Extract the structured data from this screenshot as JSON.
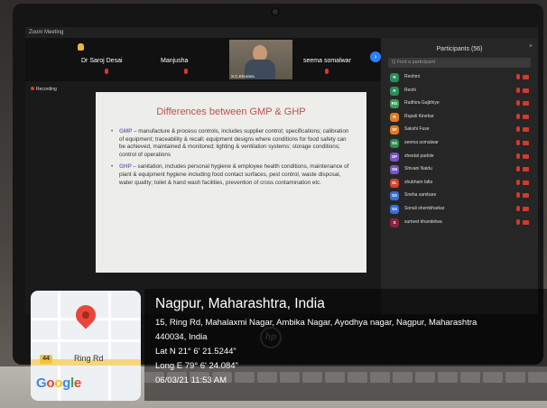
{
  "window": {
    "title": "Zoom Meeting"
  },
  "gallery": {
    "participants": [
      "Dr Saroj Desai",
      "Manjusha",
      "seema somalwar"
    ],
    "active_video_label": "S.C.Khurana"
  },
  "stage": {
    "recording_label": "Recording"
  },
  "slide": {
    "title": "Differences between GMP & GHP",
    "bullets": [
      {
        "keyword": "GMP –",
        "text": " manufacture & process controls, includes supplier control; specifications; calibration of equipment; traceability & recall; equipment designs where conditions for food safety can be achieved, maintained & monitored; lighting & ventilation systems; storage conditions; control of operations"
      },
      {
        "keyword": "GHP –",
        "text": "  sanitation, includes personal hygiene & employee health conditions, maintenance of plant & equipment hygiene including food contact surfaces, pest control, waste disposal, water quality; toilet & hand wash facilities, prevention of cross contamination etc."
      }
    ]
  },
  "participants_panel": {
    "title": "Participants (56)",
    "search_placeholder": "Q Find a participant",
    "items": [
      {
        "initials": "R",
        "name": "Reshmi",
        "color": "#2e8b57"
      },
      {
        "initials": "R",
        "name": "Reshi",
        "color": "#2e8b57"
      },
      {
        "initials": "RG",
        "name": "Rudhira Gajbhiye",
        "color": "#3a9d5d"
      },
      {
        "initials": "R",
        "name": "Rupali Kinekar",
        "color": "#e07b20"
      },
      {
        "initials": "SF",
        "name": "Sakshi Fuse",
        "color": "#e07b20"
      },
      {
        "initials": "SS",
        "name": "seema somalwar",
        "color": "#2e8b57"
      },
      {
        "initials": "SP",
        "name": "sheetal padole",
        "color": "#7b52c4"
      },
      {
        "initials": "SN",
        "name": "Shivani Naidu",
        "color": "#7b52c4"
      },
      {
        "initials": "SL",
        "name": "shubham lafia",
        "color": "#d0452f"
      },
      {
        "initials": "SS",
        "name": "Sneha sambare",
        "color": "#3a6fd0"
      },
      {
        "initials": "SS",
        "name": "Sonali shembharkar",
        "color": "#3a6fd0"
      },
      {
        "initials": "S",
        "name": "sumeet khandelwa",
        "color": "#8a2340"
      }
    ]
  },
  "map": {
    "route_number": "44",
    "road_name": "Ring Rd",
    "brand": [
      "G",
      "o",
      "o",
      "g",
      "l",
      "e"
    ],
    "brand_colors": [
      "#4285f4",
      "#ea4335",
      "#fbbc05",
      "#4285f4",
      "#34a853",
      "#ea4335"
    ]
  },
  "geotag": {
    "place": "Nagpur, Maharashtra, India",
    "address_line1": "15, Ring Rd, Mahalaxmi Nagar, Ambika Nagar, Ayodhya nagar, Nagpur, Maharashtra",
    "address_line2": "440034, India",
    "latitude": "Lat N 21° 6' 21.5244\"",
    "longitude": "Long E 79° 6' 24.084\"",
    "datetime": "06/03/21 11:53 AM"
  },
  "laptop": {
    "logo": "hp"
  }
}
